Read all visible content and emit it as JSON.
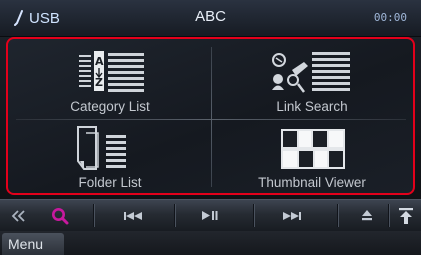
{
  "status_bar": {
    "source": "USB",
    "title": "ABC",
    "time": "00:00"
  },
  "menu_grid": {
    "items": [
      {
        "label": "Category List",
        "icon": "category-list-icon"
      },
      {
        "label": "Link Search",
        "icon": "link-search-icon"
      },
      {
        "label": "Folder List",
        "icon": "folder-list-icon"
      },
      {
        "label": "Thumbnail Viewer",
        "icon": "thumbnail-viewer-icon"
      }
    ],
    "highlight_color": "#e3001b"
  },
  "controls": {
    "buttons": [
      {
        "name": "collapse",
        "icon": "double-chevron-left-icon"
      },
      {
        "name": "search",
        "icon": "search-icon",
        "accent": "#c8199e"
      },
      {
        "name": "previous",
        "icon": "skip-previous-icon"
      },
      {
        "name": "play-pause",
        "icon": "play-pause-icon"
      },
      {
        "name": "next",
        "icon": "skip-next-icon"
      },
      {
        "name": "eject",
        "icon": "eject-icon"
      },
      {
        "name": "top",
        "icon": "arrow-up-to-top-icon"
      }
    ]
  },
  "menu_bar": {
    "menu_label": "Menu"
  }
}
